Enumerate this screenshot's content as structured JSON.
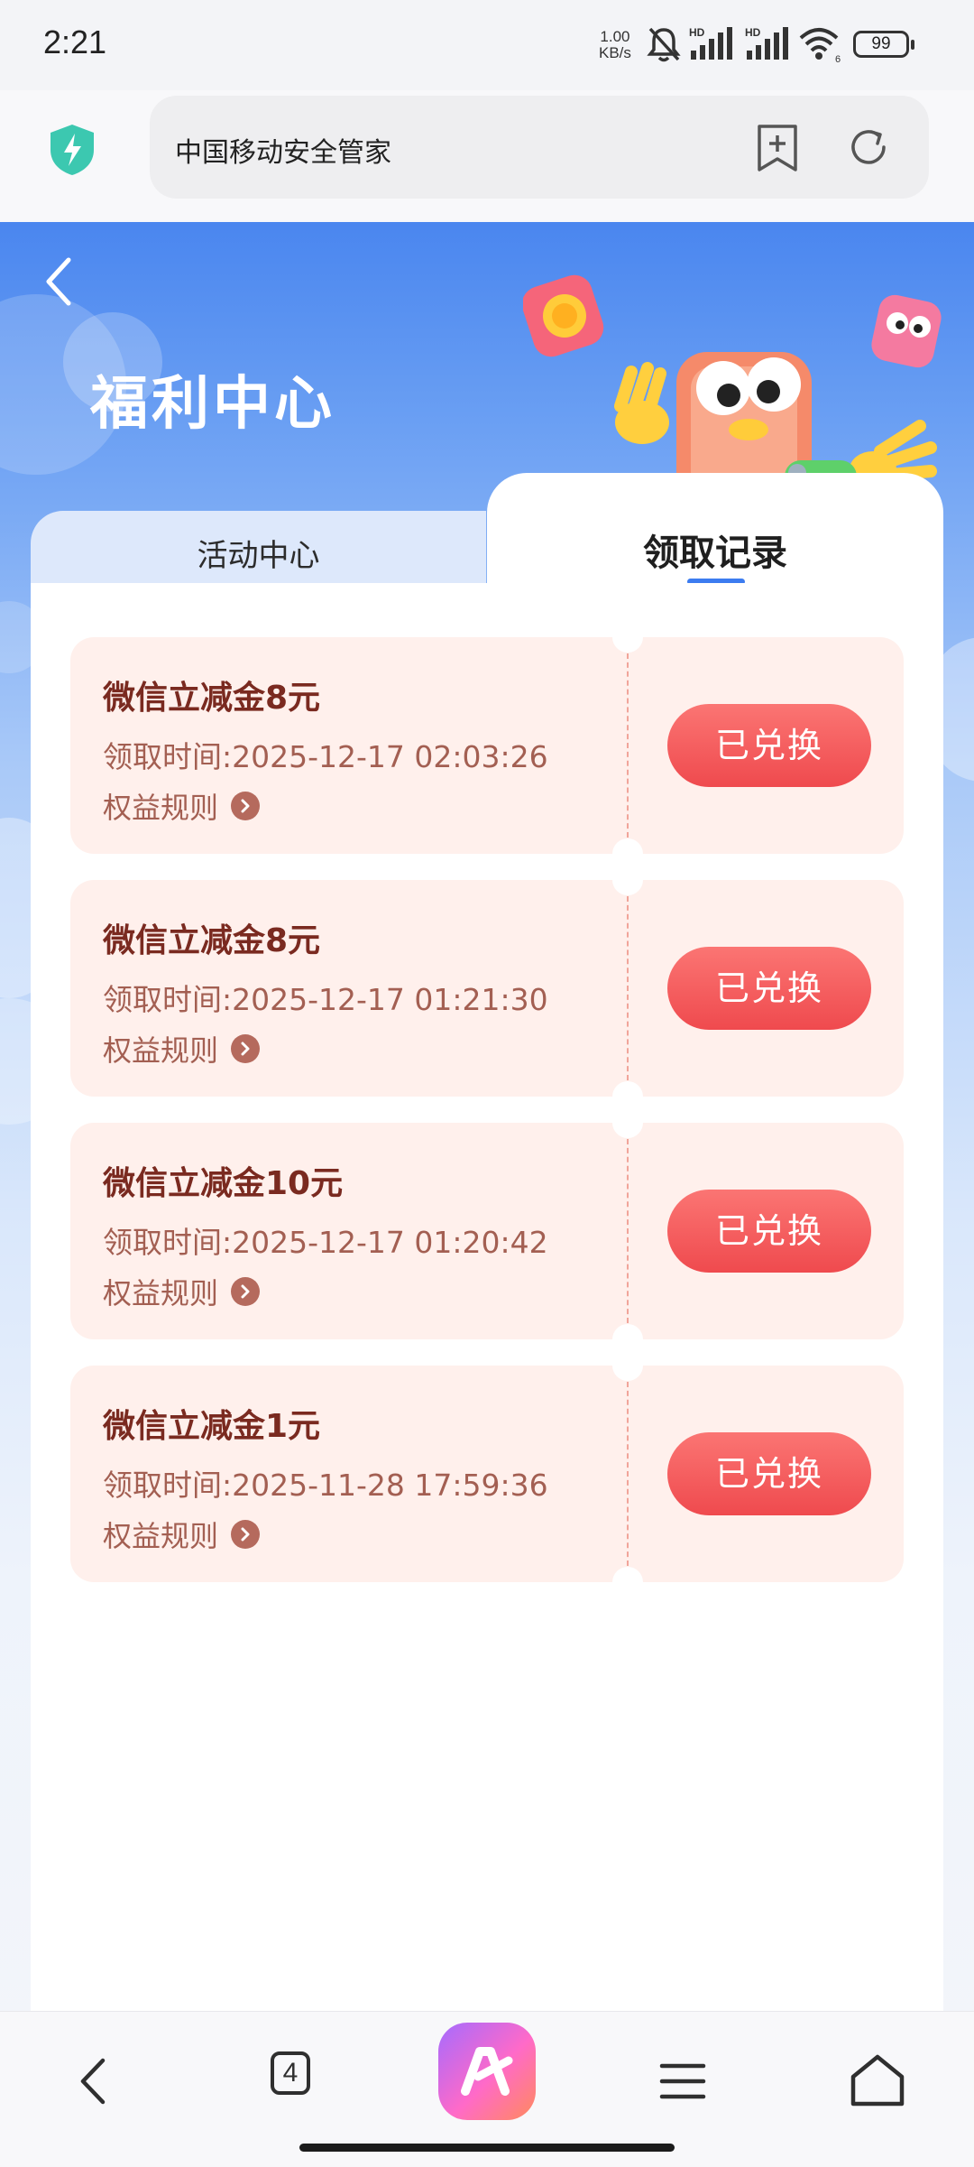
{
  "status_bar": {
    "time": "2:21",
    "net_speed_value": "1.00",
    "net_speed_unit": "KB/s",
    "wifi_label": "6",
    "battery": "99"
  },
  "browser": {
    "url_title": "中国移动安全管家"
  },
  "page": {
    "title": "福利中心",
    "tabs": [
      {
        "label": "活动中心",
        "active": false
      },
      {
        "label": "领取记录",
        "active": true
      }
    ]
  },
  "records": [
    {
      "title": "微信立减金8元",
      "time_label": "领取时间:",
      "time": "2025-12-17 02:03:26",
      "rule_label": "权益规则",
      "button": "已兑换"
    },
    {
      "title": "微信立减金8元",
      "time_label": "领取时间:",
      "time": "2025-12-17 01:21:30",
      "rule_label": "权益规则",
      "button": "已兑换"
    },
    {
      "title": "微信立减金10元",
      "time_label": "领取时间:",
      "time": "2025-12-17 01:20:42",
      "rule_label": "权益规则",
      "button": "已兑换"
    },
    {
      "title": "微信立减金1元",
      "time_label": "领取时间:",
      "time": "2025-11-28 17:59:36",
      "rule_label": "权益规则",
      "button": "已兑换"
    }
  ],
  "bottom_nav": {
    "tab_count": "4"
  },
  "colors": {
    "accent_blue": "#3c7cf0",
    "card_bg": "#fff0ec",
    "button_red": "#ef4a4e",
    "title_brown": "#7a2a20"
  },
  "icons": [
    "bell-muted-icon",
    "signal-icon",
    "wifi-icon",
    "shield-icon",
    "bookmark-add-icon",
    "reload-icon",
    "back-arrow-icon",
    "chevron-right-icon",
    "menu-icon",
    "home-icon",
    "ai-assistant-icon"
  ]
}
